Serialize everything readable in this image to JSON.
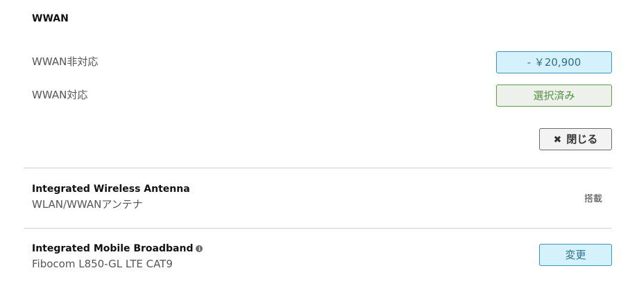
{
  "wwan_section": {
    "title": "WWAN",
    "options": [
      {
        "label": "WWAN非対応",
        "button": "- ￥20,900"
      },
      {
        "label": "WWAN対応",
        "button": "選択済み"
      }
    ],
    "close_label": "閉じる",
    "close_icon": "close-icon"
  },
  "items": [
    {
      "title": "Integrated Wireless Antenna",
      "subtitle": "WLAN/WWANアンテナ",
      "status": "搭載"
    },
    {
      "title": "Integrated Mobile Broadband",
      "subtitle": "Fibocom L850-GL LTE CAT9",
      "info_icon": "info-icon",
      "button": "変更"
    }
  ],
  "colors": {
    "price_button_bg": "#d5f1fb",
    "price_button_border": "#3a94b8",
    "selected_button_border": "#5c9c4a",
    "selected_button_text": "#4f8f3f"
  }
}
